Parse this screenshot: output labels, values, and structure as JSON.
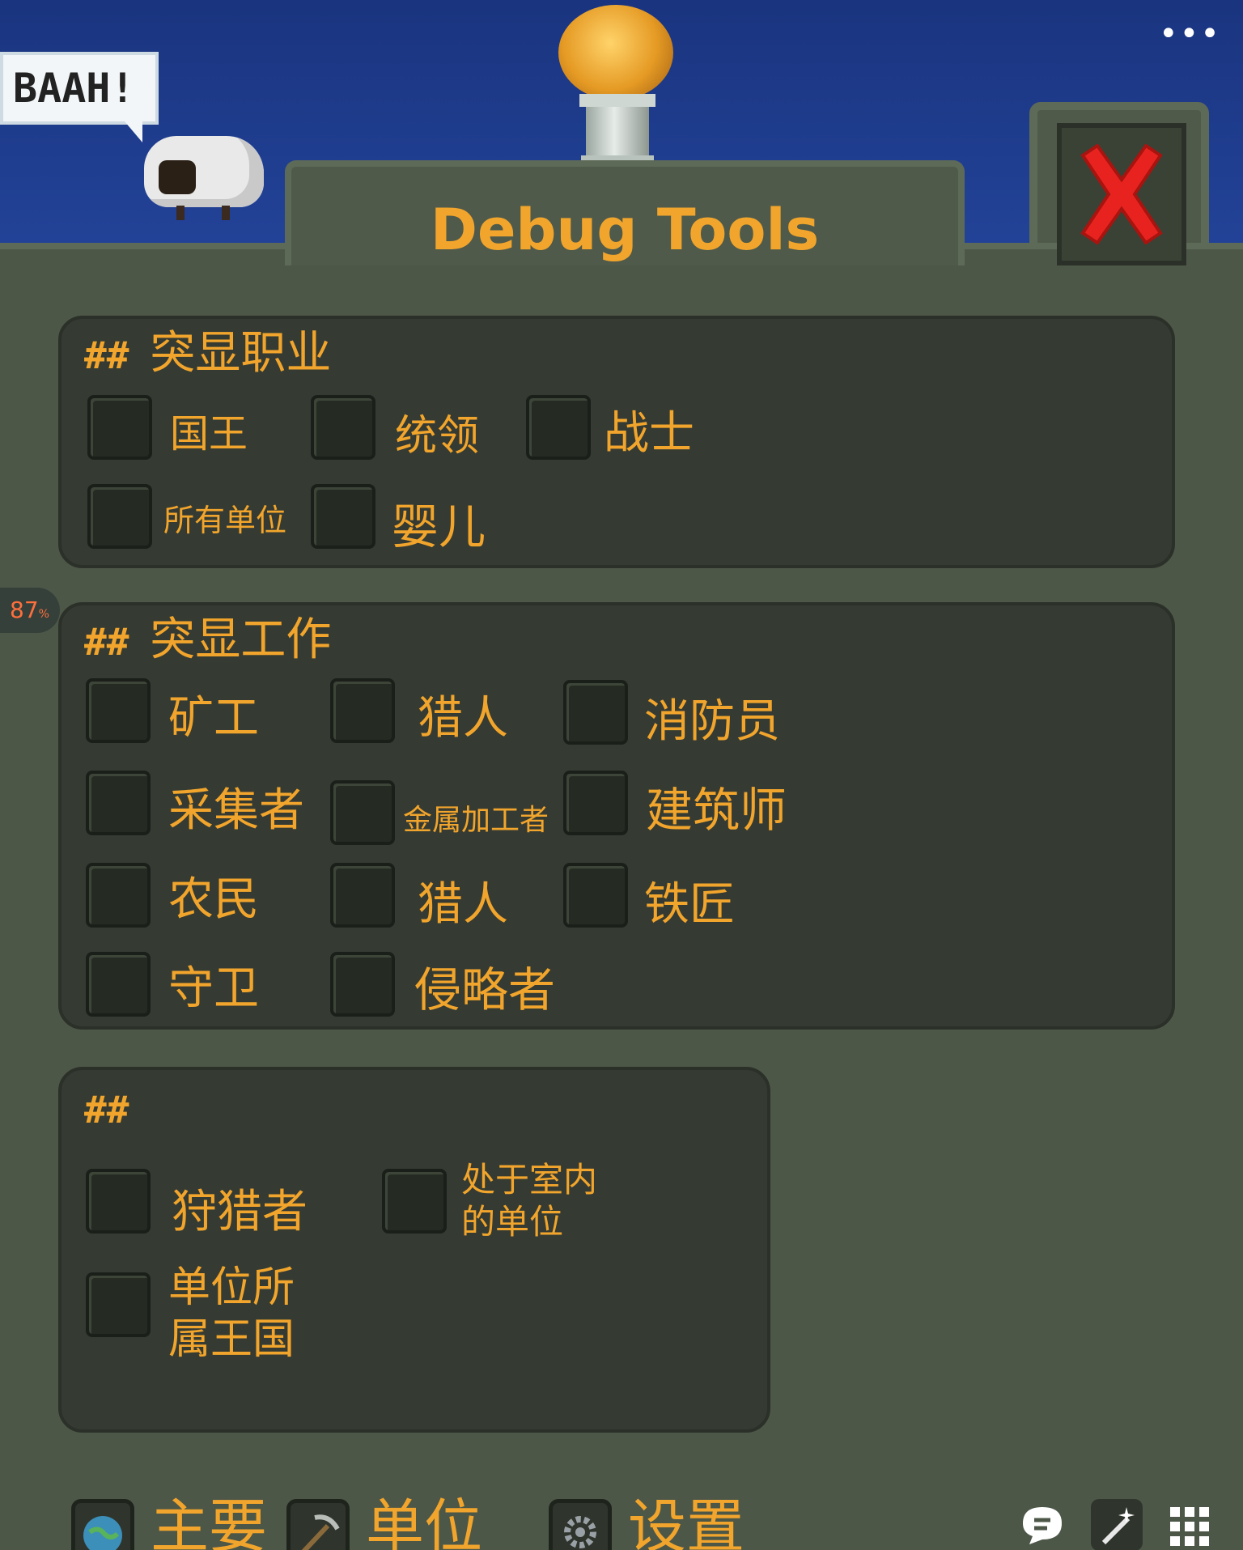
{
  "topbar": {
    "more_icon": "more-icon",
    "more_glyph": "•••"
  },
  "speech_bubble": {
    "text": "BAAH!"
  },
  "percent_badge": {
    "value": "87",
    "unit": "%"
  },
  "window": {
    "title": "Debug Tools",
    "close_icon": "close-x-icon"
  },
  "sections": [
    {
      "hash": "##",
      "title": "突显职业",
      "options": [
        "国王",
        "统领",
        "战士",
        "所有单位",
        "婴儿"
      ]
    },
    {
      "hash": "##",
      "title": "突显工作",
      "options": [
        "矿工",
        "猎人",
        "消防员",
        "采集者",
        "金属加工者",
        "建筑师",
        "农民",
        "猎人",
        "铁匠",
        "守卫",
        "侵略者"
      ]
    },
    {
      "hash": "##",
      "title": "",
      "options": [
        "狩猎者",
        "处于室内",
        "的单位",
        "单位所",
        "属王国"
      ]
    }
  ],
  "bottom_tabs": [
    {
      "label": "主要",
      "icon": "globe-icon"
    },
    {
      "label": "单位",
      "icon": "pickaxe-icon"
    },
    {
      "label": "设置",
      "icon": "gear-icon"
    }
  ],
  "system_icons": [
    "chat-bubble-icon",
    "magic-wand-icon",
    "grid-menu-icon"
  ]
}
